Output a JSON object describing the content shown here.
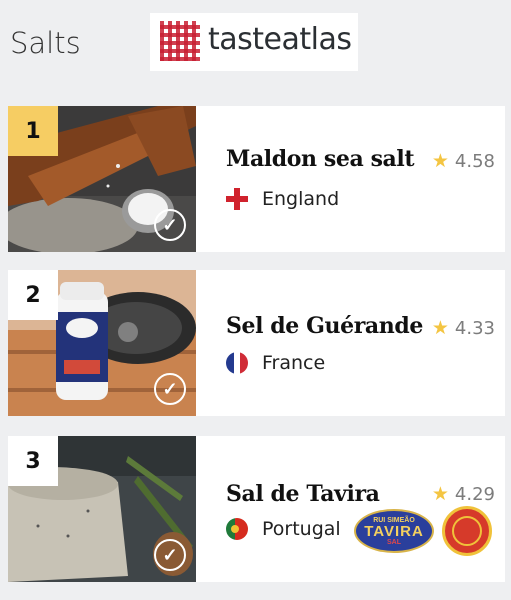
{
  "header": {
    "title": "Salts",
    "logo_text": "tasteatlas"
  },
  "items": [
    {
      "rank": "1",
      "name": "Maldon sea salt",
      "rating": "4.58",
      "country": "England",
      "flag": "england-flag"
    },
    {
      "rank": "2",
      "name": "Sel de Guérande",
      "rating": "4.33",
      "country": "France",
      "flag": "france-flag"
    },
    {
      "rank": "3",
      "name": "Sal de Tavira",
      "rating": "4.29",
      "country": "Portugal",
      "flag": "portugal-flag",
      "badge_top": "RUI SIMEÃO",
      "badge_main": "TAVIRA",
      "badge_bottom": "SAL"
    }
  ],
  "colors": {
    "rank_gold": "#f6cd63",
    "star": "#f4c542",
    "england_red": "#d0222d"
  }
}
